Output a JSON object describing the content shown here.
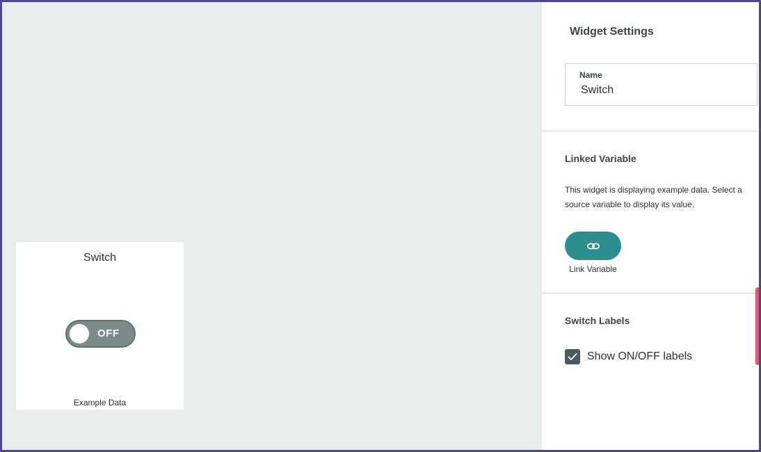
{
  "widget": {
    "title": "Switch",
    "toggle_state": "OFF",
    "footer": "Example Data"
  },
  "settings": {
    "title": "Widget Settings",
    "name_field": {
      "label": "Name",
      "value": "Switch"
    },
    "linked_variable": {
      "title": "Linked Variable",
      "description": "This widget is displaying example data. Select a source variable to display its value.",
      "button_label": "Link Variable",
      "button_icon": "link-icon"
    },
    "switch_labels": {
      "title": "Switch Labels",
      "checkbox_label": "Show ON/OFF labels",
      "checked": true
    }
  },
  "colors": {
    "frame_border": "#4f4594",
    "canvas_bg": "#e7eded",
    "toggle_off": "#7b8b8b",
    "accent_teal": "#2d8f8d",
    "scroll_indicator": "#e35a6c",
    "checkbox": "#4f5a5e"
  }
}
